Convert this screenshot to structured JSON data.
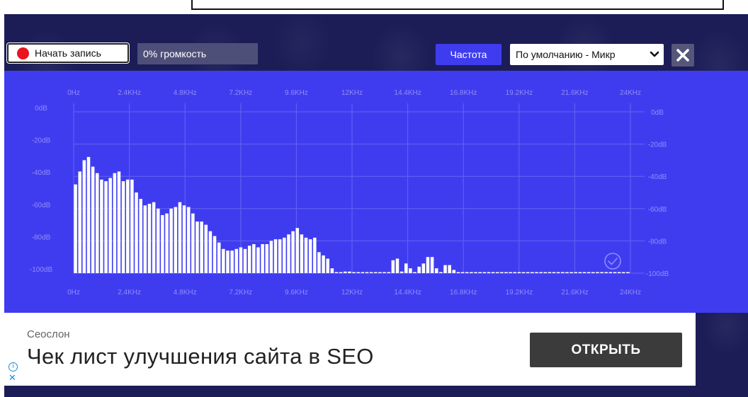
{
  "toolbar": {
    "record_label": "Начать запись",
    "volume_text": "0% громкость",
    "frequency_label": "Частота",
    "device_selected": "По умолчанию - Микр"
  },
  "colors": {
    "window_background": "#1c1d57",
    "chart_background": "#3f3cf0",
    "record_dot": "#e8141f",
    "bars": "#ffffff",
    "grid": "#6563f3",
    "axis_text": "#8f8df7"
  },
  "icons": {
    "record": "red-dot",
    "select": "chevron-down",
    "close": "x-mark",
    "status": "check-circle",
    "ad_info": "info-circle",
    "ad_close": "x-mark"
  },
  "chart_data": {
    "type": "bar",
    "x_tick_labels": [
      "0Hz",
      "2.4KHz",
      "4.8KHz",
      "7.2KHz",
      "9.6KHz",
      "12KHz",
      "14.4KHz",
      "16.8KHz",
      "19.2KHz",
      "21.6KHz",
      "24KHz"
    ],
    "y_tick_labels": [
      "0dB",
      "-20dB",
      "-40dB",
      "-60dB",
      "-80dB",
      "-100dB"
    ],
    "xlim": [
      0,
      24000
    ],
    "ylim": [
      -100,
      0
    ],
    "x_unit": "Hz",
    "y_unit": "dB",
    "grid": true,
    "bin_width_hz": 187.5,
    "values": [
      -45,
      -37,
      -30,
      -28,
      -34,
      -38,
      -42,
      -43,
      -41,
      -38,
      -37,
      -43,
      -42,
      -42,
      -50,
      -54,
      -58,
      -57,
      -56,
      -60,
      -64,
      -63,
      -60,
      -59,
      -56,
      -58,
      -59,
      -63,
      -68,
      -68,
      -70,
      -74,
      -77,
      -81,
      -85,
      -86,
      -86,
      -85,
      -84,
      -85,
      -83,
      -82,
      -84,
      -82,
      -82,
      -80,
      -79,
      -79,
      -78,
      -76,
      -74,
      -72,
      -76,
      -78,
      -79,
      -78,
      -87,
      -89,
      -91,
      -97,
      -100,
      -100,
      -99,
      -99,
      -100,
      -100,
      -100,
      -100,
      -100,
      -100,
      -100,
      -100,
      -100,
      -92,
      -91,
      -99,
      -94,
      -97,
      -100,
      -96,
      -94,
      -90,
      -90,
      -97,
      -100,
      -95,
      -95,
      -98,
      -100,
      -100,
      -100,
      -100,
      -100,
      -100,
      -100,
      -100,
      -100,
      -100,
      -100,
      -100,
      -100,
      -100,
      -100,
      -100,
      -100,
      -100,
      -100,
      -100,
      -100,
      -100,
      -100,
      -100,
      -100,
      -100,
      -100,
      -100,
      -100,
      -100,
      -100,
      -100,
      -100,
      -100,
      -100,
      -100,
      -100,
      -100,
      -100,
      -100
    ]
  },
  "ad": {
    "advertiser": "Сеослон",
    "headline": "Чек лист улучшения сайта в SEO",
    "cta": "ОТКРЫТЬ"
  }
}
